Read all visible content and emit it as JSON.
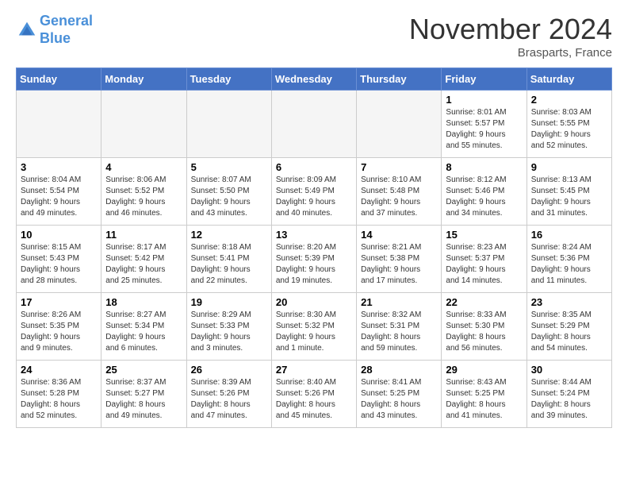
{
  "header": {
    "logo_line1": "General",
    "logo_line2": "Blue",
    "title": "November 2024",
    "location": "Brasparts, France"
  },
  "days_of_week": [
    "Sunday",
    "Monday",
    "Tuesday",
    "Wednesday",
    "Thursday",
    "Friday",
    "Saturday"
  ],
  "weeks": [
    {
      "days": [
        {
          "num": "",
          "info": ""
        },
        {
          "num": "",
          "info": ""
        },
        {
          "num": "",
          "info": ""
        },
        {
          "num": "",
          "info": ""
        },
        {
          "num": "",
          "info": ""
        },
        {
          "num": "1",
          "info": "Sunrise: 8:01 AM\nSunset: 5:57 PM\nDaylight: 9 hours\nand 55 minutes."
        },
        {
          "num": "2",
          "info": "Sunrise: 8:03 AM\nSunset: 5:55 PM\nDaylight: 9 hours\nand 52 minutes."
        }
      ]
    },
    {
      "days": [
        {
          "num": "3",
          "info": "Sunrise: 8:04 AM\nSunset: 5:54 PM\nDaylight: 9 hours\nand 49 minutes."
        },
        {
          "num": "4",
          "info": "Sunrise: 8:06 AM\nSunset: 5:52 PM\nDaylight: 9 hours\nand 46 minutes."
        },
        {
          "num": "5",
          "info": "Sunrise: 8:07 AM\nSunset: 5:50 PM\nDaylight: 9 hours\nand 43 minutes."
        },
        {
          "num": "6",
          "info": "Sunrise: 8:09 AM\nSunset: 5:49 PM\nDaylight: 9 hours\nand 40 minutes."
        },
        {
          "num": "7",
          "info": "Sunrise: 8:10 AM\nSunset: 5:48 PM\nDaylight: 9 hours\nand 37 minutes."
        },
        {
          "num": "8",
          "info": "Sunrise: 8:12 AM\nSunset: 5:46 PM\nDaylight: 9 hours\nand 34 minutes."
        },
        {
          "num": "9",
          "info": "Sunrise: 8:13 AM\nSunset: 5:45 PM\nDaylight: 9 hours\nand 31 minutes."
        }
      ]
    },
    {
      "days": [
        {
          "num": "10",
          "info": "Sunrise: 8:15 AM\nSunset: 5:43 PM\nDaylight: 9 hours\nand 28 minutes."
        },
        {
          "num": "11",
          "info": "Sunrise: 8:17 AM\nSunset: 5:42 PM\nDaylight: 9 hours\nand 25 minutes."
        },
        {
          "num": "12",
          "info": "Sunrise: 8:18 AM\nSunset: 5:41 PM\nDaylight: 9 hours\nand 22 minutes."
        },
        {
          "num": "13",
          "info": "Sunrise: 8:20 AM\nSunset: 5:39 PM\nDaylight: 9 hours\nand 19 minutes."
        },
        {
          "num": "14",
          "info": "Sunrise: 8:21 AM\nSunset: 5:38 PM\nDaylight: 9 hours\nand 17 minutes."
        },
        {
          "num": "15",
          "info": "Sunrise: 8:23 AM\nSunset: 5:37 PM\nDaylight: 9 hours\nand 14 minutes."
        },
        {
          "num": "16",
          "info": "Sunrise: 8:24 AM\nSunset: 5:36 PM\nDaylight: 9 hours\nand 11 minutes."
        }
      ]
    },
    {
      "days": [
        {
          "num": "17",
          "info": "Sunrise: 8:26 AM\nSunset: 5:35 PM\nDaylight: 9 hours\nand 9 minutes."
        },
        {
          "num": "18",
          "info": "Sunrise: 8:27 AM\nSunset: 5:34 PM\nDaylight: 9 hours\nand 6 minutes."
        },
        {
          "num": "19",
          "info": "Sunrise: 8:29 AM\nSunset: 5:33 PM\nDaylight: 9 hours\nand 3 minutes."
        },
        {
          "num": "20",
          "info": "Sunrise: 8:30 AM\nSunset: 5:32 PM\nDaylight: 9 hours\nand 1 minute."
        },
        {
          "num": "21",
          "info": "Sunrise: 8:32 AM\nSunset: 5:31 PM\nDaylight: 8 hours\nand 59 minutes."
        },
        {
          "num": "22",
          "info": "Sunrise: 8:33 AM\nSunset: 5:30 PM\nDaylight: 8 hours\nand 56 minutes."
        },
        {
          "num": "23",
          "info": "Sunrise: 8:35 AM\nSunset: 5:29 PM\nDaylight: 8 hours\nand 54 minutes."
        }
      ]
    },
    {
      "days": [
        {
          "num": "24",
          "info": "Sunrise: 8:36 AM\nSunset: 5:28 PM\nDaylight: 8 hours\nand 52 minutes."
        },
        {
          "num": "25",
          "info": "Sunrise: 8:37 AM\nSunset: 5:27 PM\nDaylight: 8 hours\nand 49 minutes."
        },
        {
          "num": "26",
          "info": "Sunrise: 8:39 AM\nSunset: 5:26 PM\nDaylight: 8 hours\nand 47 minutes."
        },
        {
          "num": "27",
          "info": "Sunrise: 8:40 AM\nSunset: 5:26 PM\nDaylight: 8 hours\nand 45 minutes."
        },
        {
          "num": "28",
          "info": "Sunrise: 8:41 AM\nSunset: 5:25 PM\nDaylight: 8 hours\nand 43 minutes."
        },
        {
          "num": "29",
          "info": "Sunrise: 8:43 AM\nSunset: 5:25 PM\nDaylight: 8 hours\nand 41 minutes."
        },
        {
          "num": "30",
          "info": "Sunrise: 8:44 AM\nSunset: 5:24 PM\nDaylight: 8 hours\nand 39 minutes."
        }
      ]
    }
  ]
}
